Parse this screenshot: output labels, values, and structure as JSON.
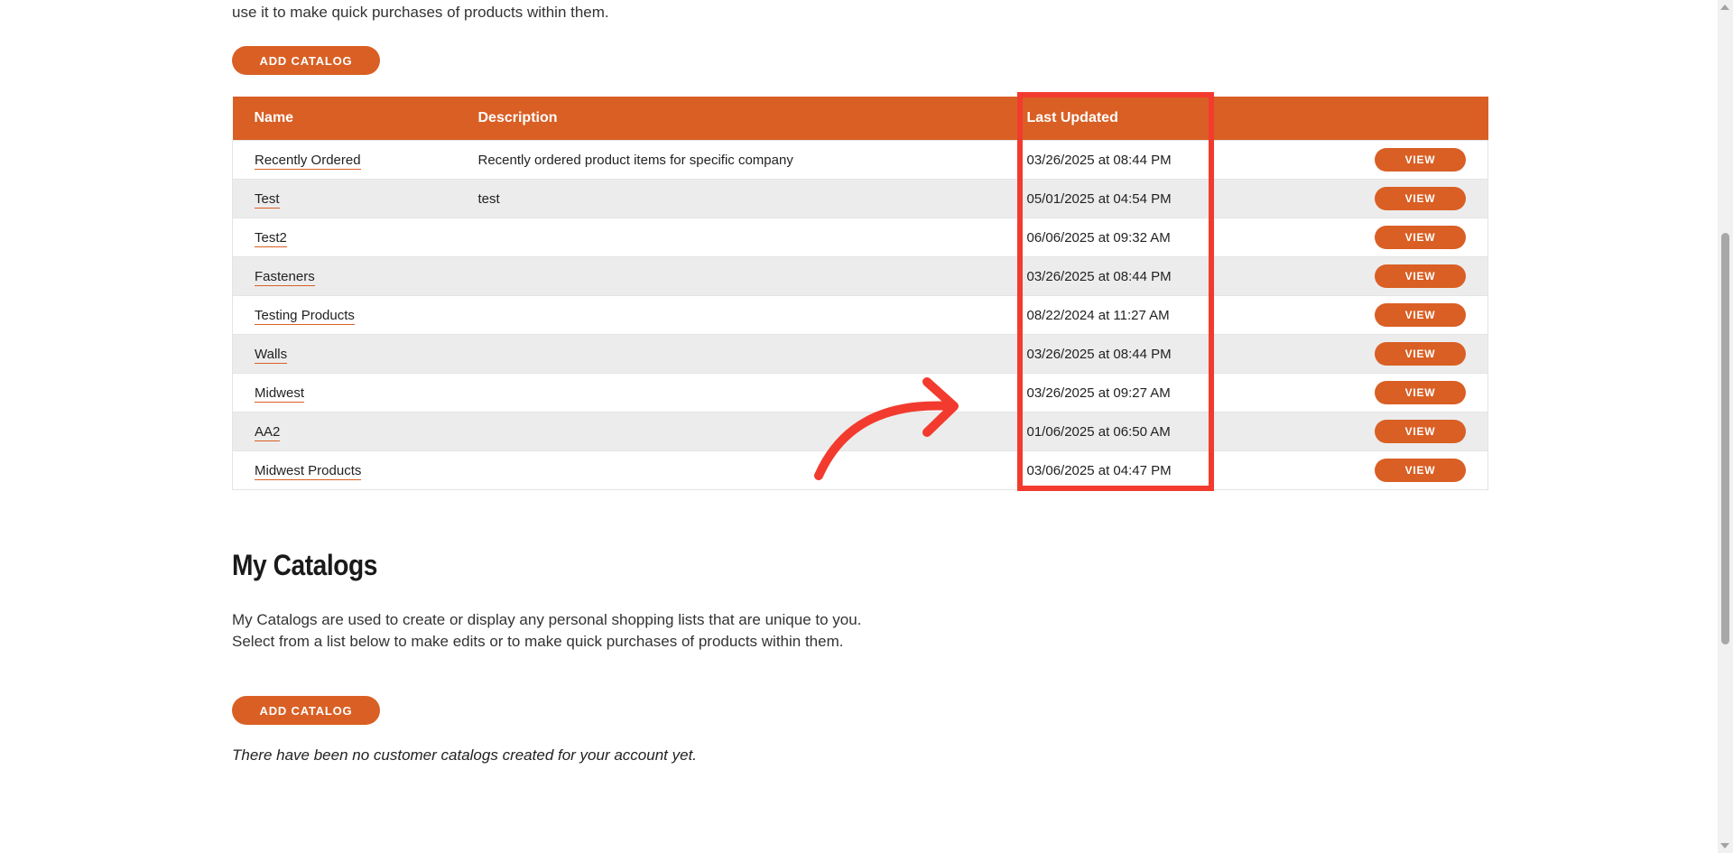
{
  "shared_catalogs": {
    "intro_tail": "use it to make quick purchases of products within them.",
    "add_button_label": "ADD CATALOG",
    "columns": {
      "name": "Name",
      "description": "Description",
      "last_updated": "Last Updated"
    },
    "rows": [
      {
        "name": "Recently Ordered",
        "description": "Recently ordered product items for specific company",
        "last_updated": "03/26/2025 at 08:44 PM",
        "action": "VIEW"
      },
      {
        "name": "Test",
        "description": "test",
        "last_updated": "05/01/2025 at 04:54 PM",
        "action": "VIEW"
      },
      {
        "name": "Test2",
        "description": "",
        "last_updated": "06/06/2025 at 09:32 AM",
        "action": "VIEW"
      },
      {
        "name": "Fasteners",
        "description": "",
        "last_updated": "03/26/2025 at 08:44 PM",
        "action": "VIEW"
      },
      {
        "name": "Testing Products",
        "description": "",
        "last_updated": "08/22/2024 at 11:27 AM",
        "action": "VIEW"
      },
      {
        "name": "Walls",
        "description": "",
        "last_updated": "03/26/2025 at 08:44 PM",
        "action": "VIEW"
      },
      {
        "name": "Midwest",
        "description": "",
        "last_updated": "03/26/2025 at 09:27 AM",
        "action": "VIEW"
      },
      {
        "name": "AA2",
        "description": "",
        "last_updated": "01/06/2025 at 06:50 AM",
        "action": "VIEW"
      },
      {
        "name": "Midwest Products",
        "description": "",
        "last_updated": "03/06/2025 at 04:47 PM",
        "action": "VIEW"
      }
    ]
  },
  "my_catalogs": {
    "title": "My Catalogs",
    "description": "My Catalogs are used to create or display any personal shopping lists that are unique to you. Select from a list below to make edits or to make quick purchases of products within them.",
    "add_button_label": "ADD CATALOG",
    "empty_message": "There have been no customer catalogs created for your account yet."
  },
  "colors": {
    "accent": "#d95f24",
    "annotation": "#f23b2e",
    "row_alt": "#ececec"
  }
}
